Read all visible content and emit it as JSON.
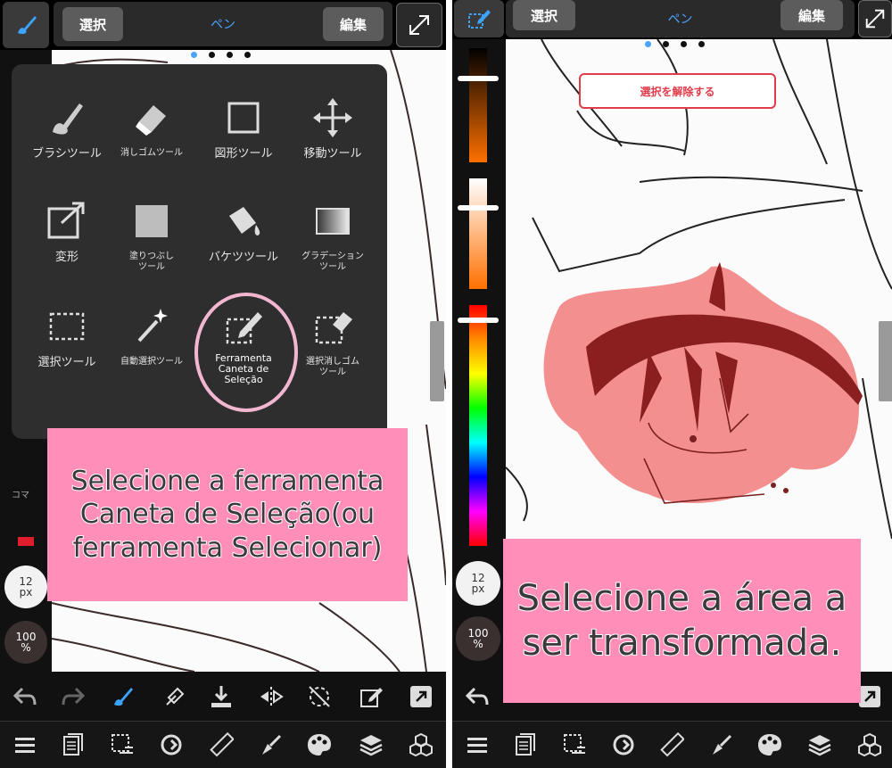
{
  "left_panel": {
    "topbar": {
      "select_label": "選択",
      "mode_label": "ペン",
      "edit_label": "編集"
    },
    "tools": [
      {
        "name": "brush",
        "label": "ブラシツール",
        "icon": "brush-icon"
      },
      {
        "name": "eraser",
        "label": "消しゴムツール",
        "icon": "eraser-icon",
        "small": true
      },
      {
        "name": "shape",
        "label": "図形ツール",
        "icon": "square-icon"
      },
      {
        "name": "move",
        "label": "移動ツール",
        "icon": "move-icon"
      },
      {
        "name": "transform",
        "label": "変形",
        "icon": "transform-icon"
      },
      {
        "name": "fill",
        "label": "塗りつぶし\nツール",
        "icon": "fill-square-icon",
        "small": true
      },
      {
        "name": "bucket",
        "label": "バケツツール",
        "icon": "bucket-icon"
      },
      {
        "name": "gradient",
        "label": "グラデーション\nツール",
        "icon": "gradient-icon",
        "small": true
      },
      {
        "name": "select",
        "label": "選択ツール",
        "icon": "selection-icon"
      },
      {
        "name": "auto-select",
        "label": "自動選択ツール",
        "icon": "magic-wand-icon",
        "small": true
      },
      {
        "name": "select-pen",
        "label": "Ferramenta\nCaneta de\nSeleção",
        "icon": "selection-pen-icon",
        "small": true,
        "light": true
      },
      {
        "name": "select-eraser",
        "label": "選択消しゴム\nツール",
        "icon": "selection-eraser-icon",
        "small": true
      }
    ],
    "partial_label": "コマ",
    "brush_size": {
      "value": "12",
      "unit": "px"
    },
    "opacity": {
      "value": "100",
      "unit": "%"
    },
    "caption": "Selecione a ferramenta\nCaneta de Seleção(ou\nferramenta Selecionar)"
  },
  "right_panel": {
    "topbar": {
      "select_label": "選択",
      "mode_label": "ペン",
      "edit_label": "編集"
    },
    "unselect_button": "選択を解除する",
    "brush_size": {
      "value": "12",
      "unit": "px"
    },
    "opacity": {
      "value": "100",
      "unit": "%"
    },
    "caption": "Selecione a área a\nser transformada."
  },
  "colors": {
    "accent": "#4aa3ff",
    "caption_bg": "#ff8fb8",
    "selection": "#f48f8f",
    "ink": "#8b1f1f"
  }
}
